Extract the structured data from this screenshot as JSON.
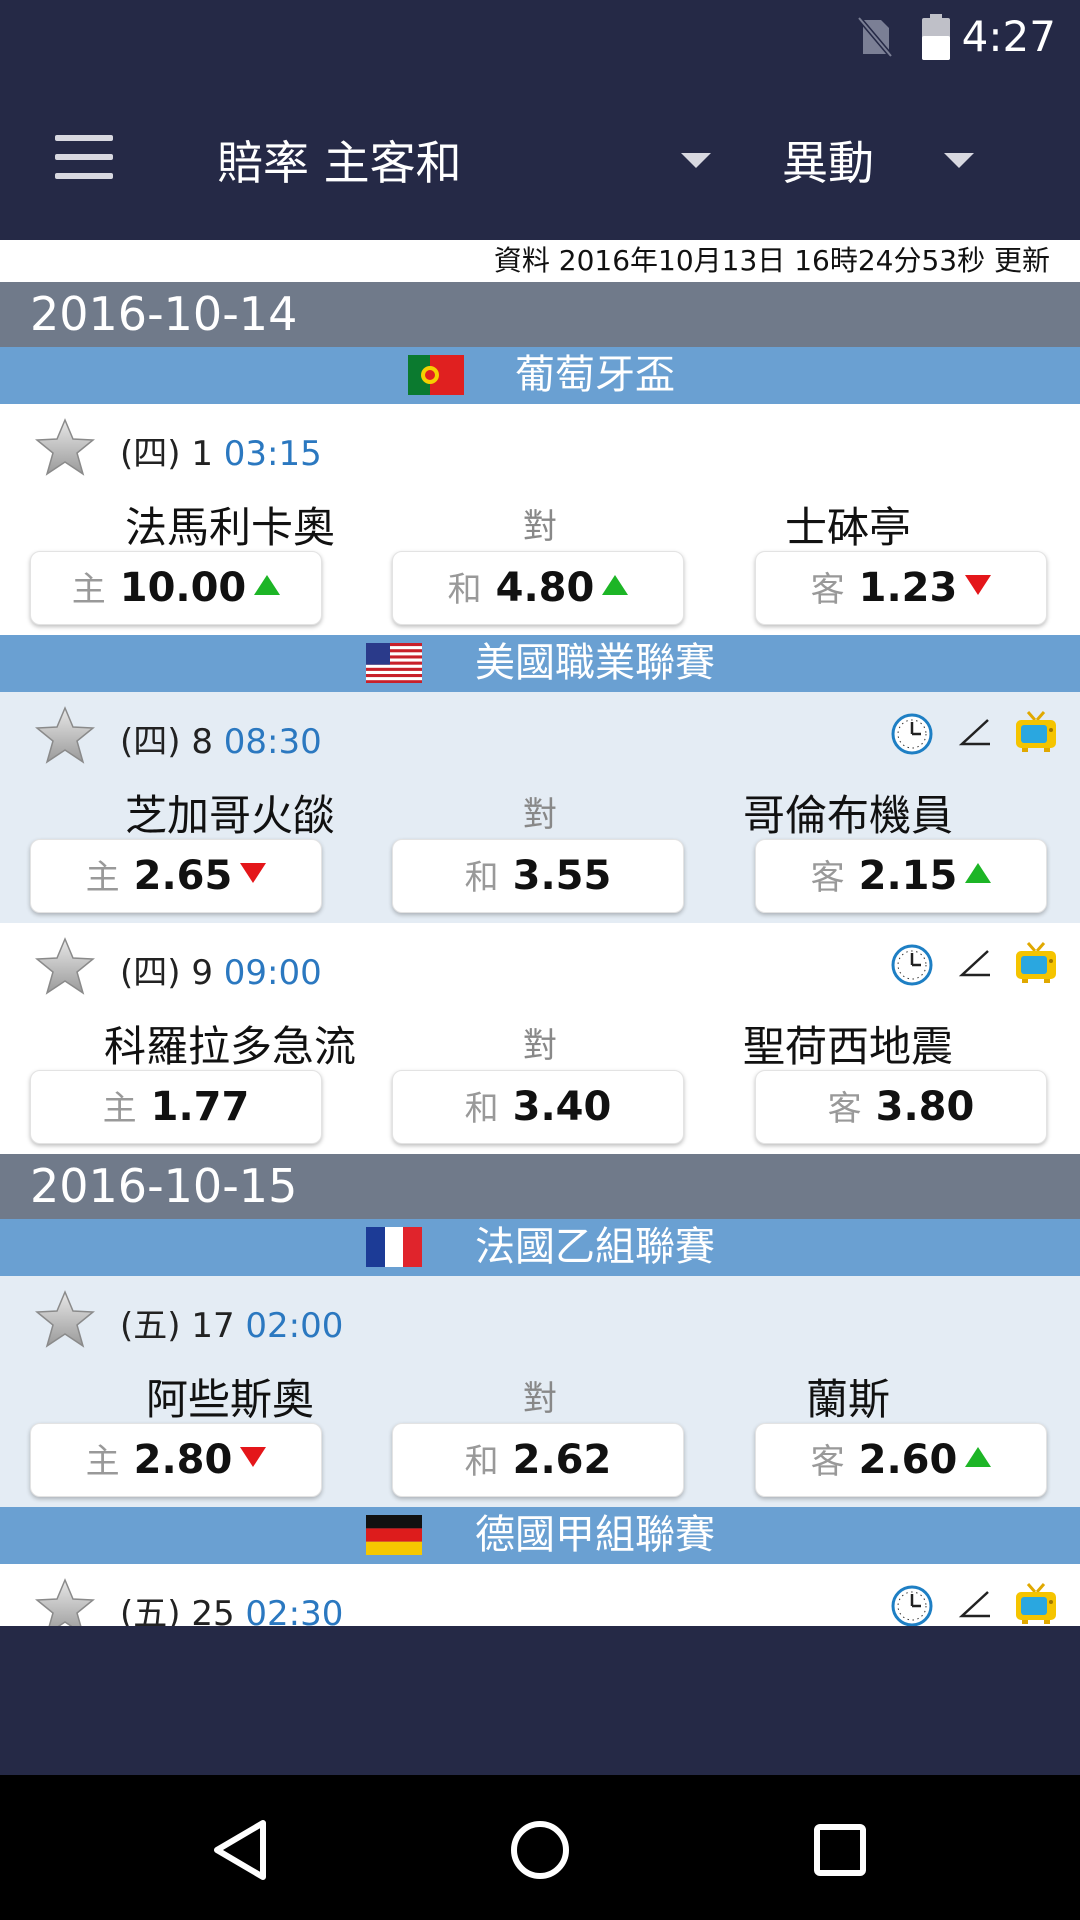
{
  "status": {
    "time": "4:27"
  },
  "appbar": {
    "title": "賠率 主客和",
    "change_label": "異動"
  },
  "update_text": "資料 2016年10月13日 16時24分53秒 更新",
  "labels": {
    "vs": "對",
    "home": "主",
    "draw": "和",
    "away": "客"
  },
  "dates": [
    "2016-10-14",
    "2016-10-15"
  ],
  "leagues": {
    "portugal": {
      "name": "葡萄牙盃",
      "flag": "portugal-flag"
    },
    "usa": {
      "name": "美國職業聯賽",
      "flag": "usa-flag"
    },
    "france": {
      "name": "法國乙組聯賽",
      "flag": "france-flag"
    },
    "germany": {
      "name": "德國甲組聯賽",
      "flag": "germany-flag"
    }
  },
  "matches": [
    {
      "day": "(四) 1",
      "time": "03:15",
      "home": "法馬利卡奧",
      "away": "士砵亭",
      "odds": {
        "home": "10.00",
        "draw": "4.80",
        "away": "1.23"
      },
      "trend": {
        "home": "up",
        "draw": "up",
        "away": "down"
      },
      "has_icons": false
    },
    {
      "day": "(四) 8",
      "time": "08:30",
      "home": "芝加哥火燄",
      "away": "哥倫布機員",
      "odds": {
        "home": "2.65",
        "draw": "3.55",
        "away": "2.15"
      },
      "trend": {
        "home": "down",
        "draw": "none",
        "away": "up"
      },
      "has_icons": true
    },
    {
      "day": "(四) 9",
      "time": "09:00",
      "home": "科羅拉多急流",
      "away": "聖荷西地震",
      "odds": {
        "home": "1.77",
        "draw": "3.40",
        "away": "3.80"
      },
      "trend": {
        "home": "none",
        "draw": "none",
        "away": "none"
      },
      "has_icons": true
    },
    {
      "day": "(五) 17",
      "time": "02:00",
      "home": "阿些斯奧",
      "away": "蘭斯",
      "odds": {
        "home": "2.80",
        "draw": "2.62",
        "away": "2.60"
      },
      "trend": {
        "home": "down",
        "draw": "none",
        "away": "up"
      },
      "has_icons": false
    },
    {
      "day": "(五) 25",
      "time": "02:30",
      "has_icons": true
    }
  ],
  "colors": {
    "header_bg": "#252946",
    "date_bg": "#707a8a",
    "league_bg": "#6aa0d2",
    "row_alt_bg": "#e4ecf4",
    "time_text": "#2b78c0",
    "up_arrow": "#1db526",
    "down_arrow": "#e4161a"
  }
}
